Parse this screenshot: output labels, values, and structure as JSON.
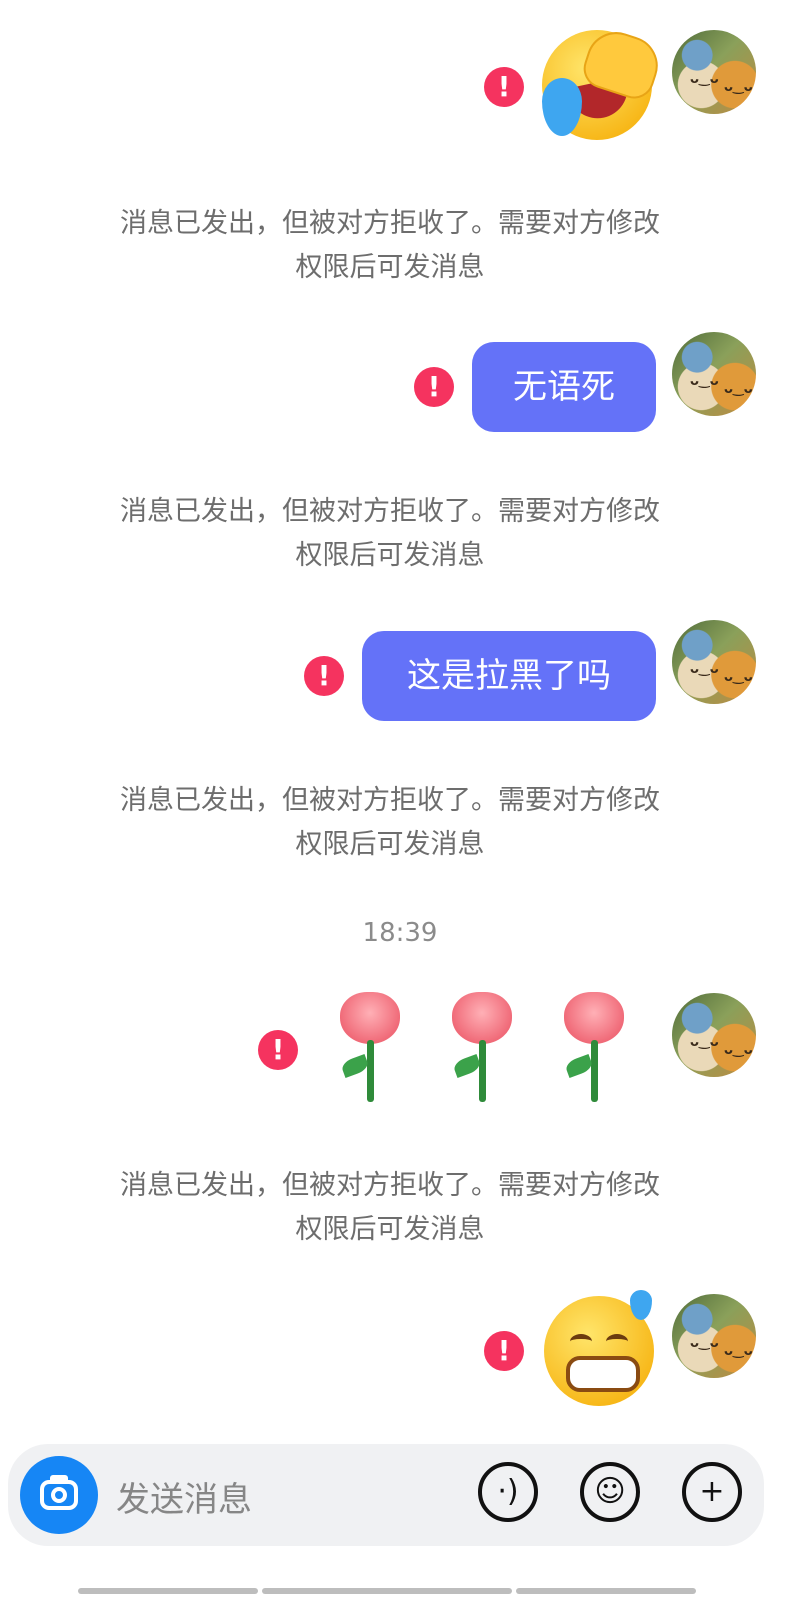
{
  "messages": [
    {
      "type": "sticker",
      "sticker": "laughing-crying-face",
      "status": "failed"
    },
    {
      "type": "text",
      "text": "无语死",
      "status": "failed"
    },
    {
      "type": "text",
      "text": "这是拉黑了吗",
      "status": "failed"
    },
    {
      "type": "timestamp",
      "text": "18:39"
    },
    {
      "type": "emoji",
      "emoji": "rose",
      "count": 3,
      "status": "failed"
    },
    {
      "type": "sticker",
      "sticker": "grinning-sweat-face",
      "status": "failed"
    }
  ],
  "system_notice": {
    "line1": "消息已发出，但被对方拒收了。需要对方修改",
    "line2": "权限后可发消息"
  },
  "failed_icon": "!",
  "composer": {
    "placeholder": "发送消息",
    "buttons": [
      "camera-icon",
      "voice-icon",
      "emoji-icon",
      "plus-icon"
    ]
  },
  "colors": {
    "bubble": "#6472f8",
    "error": "#f5335f",
    "camera": "#1686f5"
  }
}
